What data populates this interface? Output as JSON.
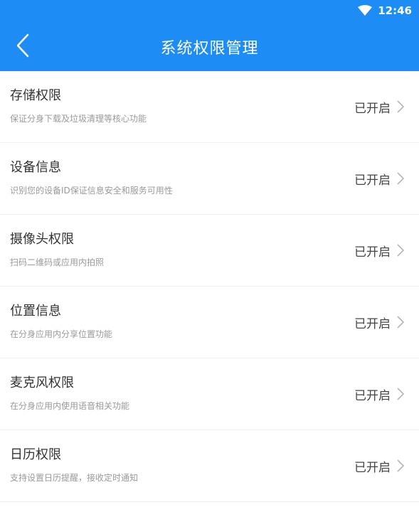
{
  "status_bar": {
    "time": "12:46"
  },
  "header": {
    "title": "系统权限管理"
  },
  "permissions": [
    {
      "title": "存储权限",
      "desc": "保证分身下载及垃圾清理等核心功能",
      "status": "已开启"
    },
    {
      "title": "设备信息",
      "desc": "识别您的设备ID保证信息安全和服务可用性",
      "status": "已开启"
    },
    {
      "title": "摄像头权限",
      "desc": "扫码二维码或应用内拍照",
      "status": "已开启"
    },
    {
      "title": "位置信息",
      "desc": "在分身应用内分享位置功能",
      "status": "已开启"
    },
    {
      "title": "麦克风权限",
      "desc": "在分身应用内使用语音相关功能",
      "status": "已开启"
    },
    {
      "title": "日历权限",
      "desc": "支持设置日历提醒，接收定时通知",
      "status": "已开启"
    }
  ],
  "colors": {
    "header_bg": "#1E8CF5",
    "title_text": "#333333",
    "desc_text": "#9a9a9a"
  }
}
